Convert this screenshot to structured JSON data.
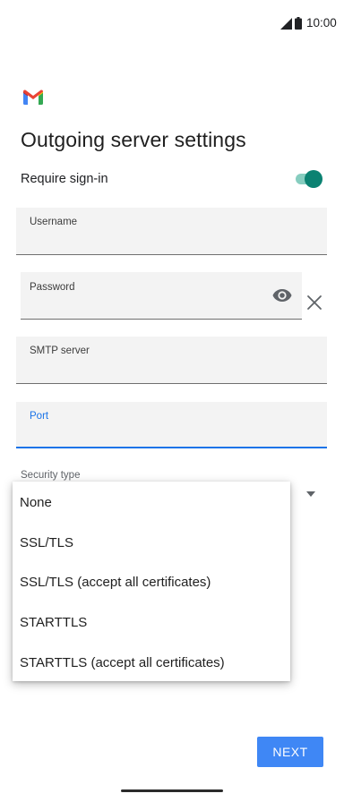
{
  "status_bar": {
    "time": "10:00"
  },
  "page": {
    "title": "Outgoing server settings"
  },
  "require_signin": {
    "label": "Require sign-in",
    "enabled": true,
    "accent_color": "#0b8272"
  },
  "fields": {
    "username": {
      "label": "Username",
      "value": ""
    },
    "password": {
      "label": "Password",
      "value": ""
    },
    "smtp_server": {
      "label": "SMTP server",
      "value": ""
    },
    "port": {
      "label": "Port",
      "value": "",
      "focused": true,
      "focus_color": "#1a73e8"
    }
  },
  "security": {
    "label": "Security type",
    "options": [
      "None",
      "SSL/TLS",
      "SSL/TLS (accept all certificates)",
      "STARTTLS",
      "STARTTLS (accept all certificates)"
    ]
  },
  "footer": {
    "next_label": "NEXT",
    "next_color": "#3f87f5"
  },
  "icons": {
    "signal": "signal-icon",
    "battery": "battery-icon",
    "logo": "gmail-logo",
    "eye": "eye-icon",
    "clear": "close-icon",
    "dropdown": "dropdown-arrow-icon"
  }
}
